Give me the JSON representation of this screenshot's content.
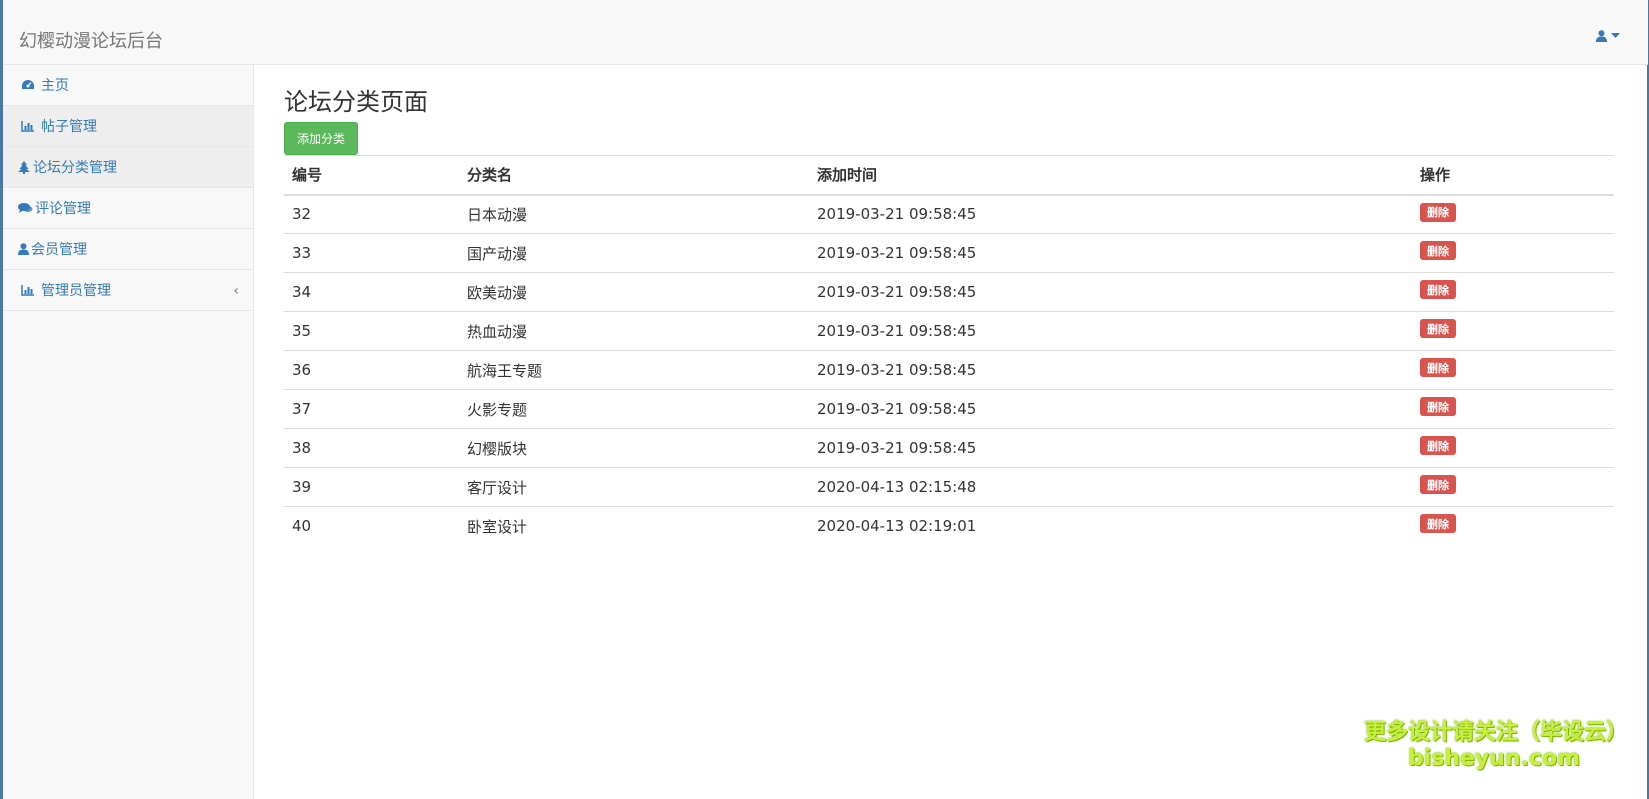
{
  "app": {
    "title": "幻樱动漫论坛后台"
  },
  "colors": {
    "accent": "#337ab7",
    "success": "#5cb85c",
    "danger": "#d9534f",
    "watermark": "#c8f03a"
  },
  "header": {
    "user_icon": "user-icon",
    "dropdown_icon": "caret-down-icon"
  },
  "sidebar": {
    "items": [
      {
        "label": "主页",
        "icon": "dashboard-icon"
      },
      {
        "label": "帖子管理",
        "icon": "bar-chart-icon"
      },
      {
        "label": "论坛分类管理",
        "icon": "tree-icon"
      },
      {
        "label": "评论管理",
        "icon": "comments-icon"
      },
      {
        "label": "会员管理",
        "icon": "user-icon"
      },
      {
        "label": "管理员管理",
        "icon": "bar-chart-icon",
        "caret": "‹"
      }
    ]
  },
  "main": {
    "title": "论坛分类页面",
    "add_button": "添加分类",
    "table": {
      "headers": [
        "编号",
        "分类名",
        "添加时间",
        "操作"
      ],
      "delete_label": "删除",
      "rows": [
        {
          "id": "32",
          "name": "日本动漫",
          "time": "2019-03-21 09:58:45"
        },
        {
          "id": "33",
          "name": "国产动漫",
          "time": "2019-03-21 09:58:45"
        },
        {
          "id": "34",
          "name": "欧美动漫",
          "time": "2019-03-21 09:58:45"
        },
        {
          "id": "35",
          "name": "热血动漫",
          "time": "2019-03-21 09:58:45"
        },
        {
          "id": "36",
          "name": "航海王专题",
          "time": "2019-03-21 09:58:45"
        },
        {
          "id": "37",
          "name": "火影专题",
          "time": "2019-03-21 09:58:45"
        },
        {
          "id": "38",
          "name": "幻樱版块",
          "time": "2019-03-21 09:58:45"
        },
        {
          "id": "39",
          "name": "客厅设计",
          "time": "2020-04-13 02:15:48"
        },
        {
          "id": "40",
          "name": "卧室设计",
          "time": "2020-04-13 02:19:01"
        }
      ]
    }
  },
  "watermark": {
    "line1": "更多设计请关注（毕设云）",
    "line2": "bisheyun.com"
  }
}
